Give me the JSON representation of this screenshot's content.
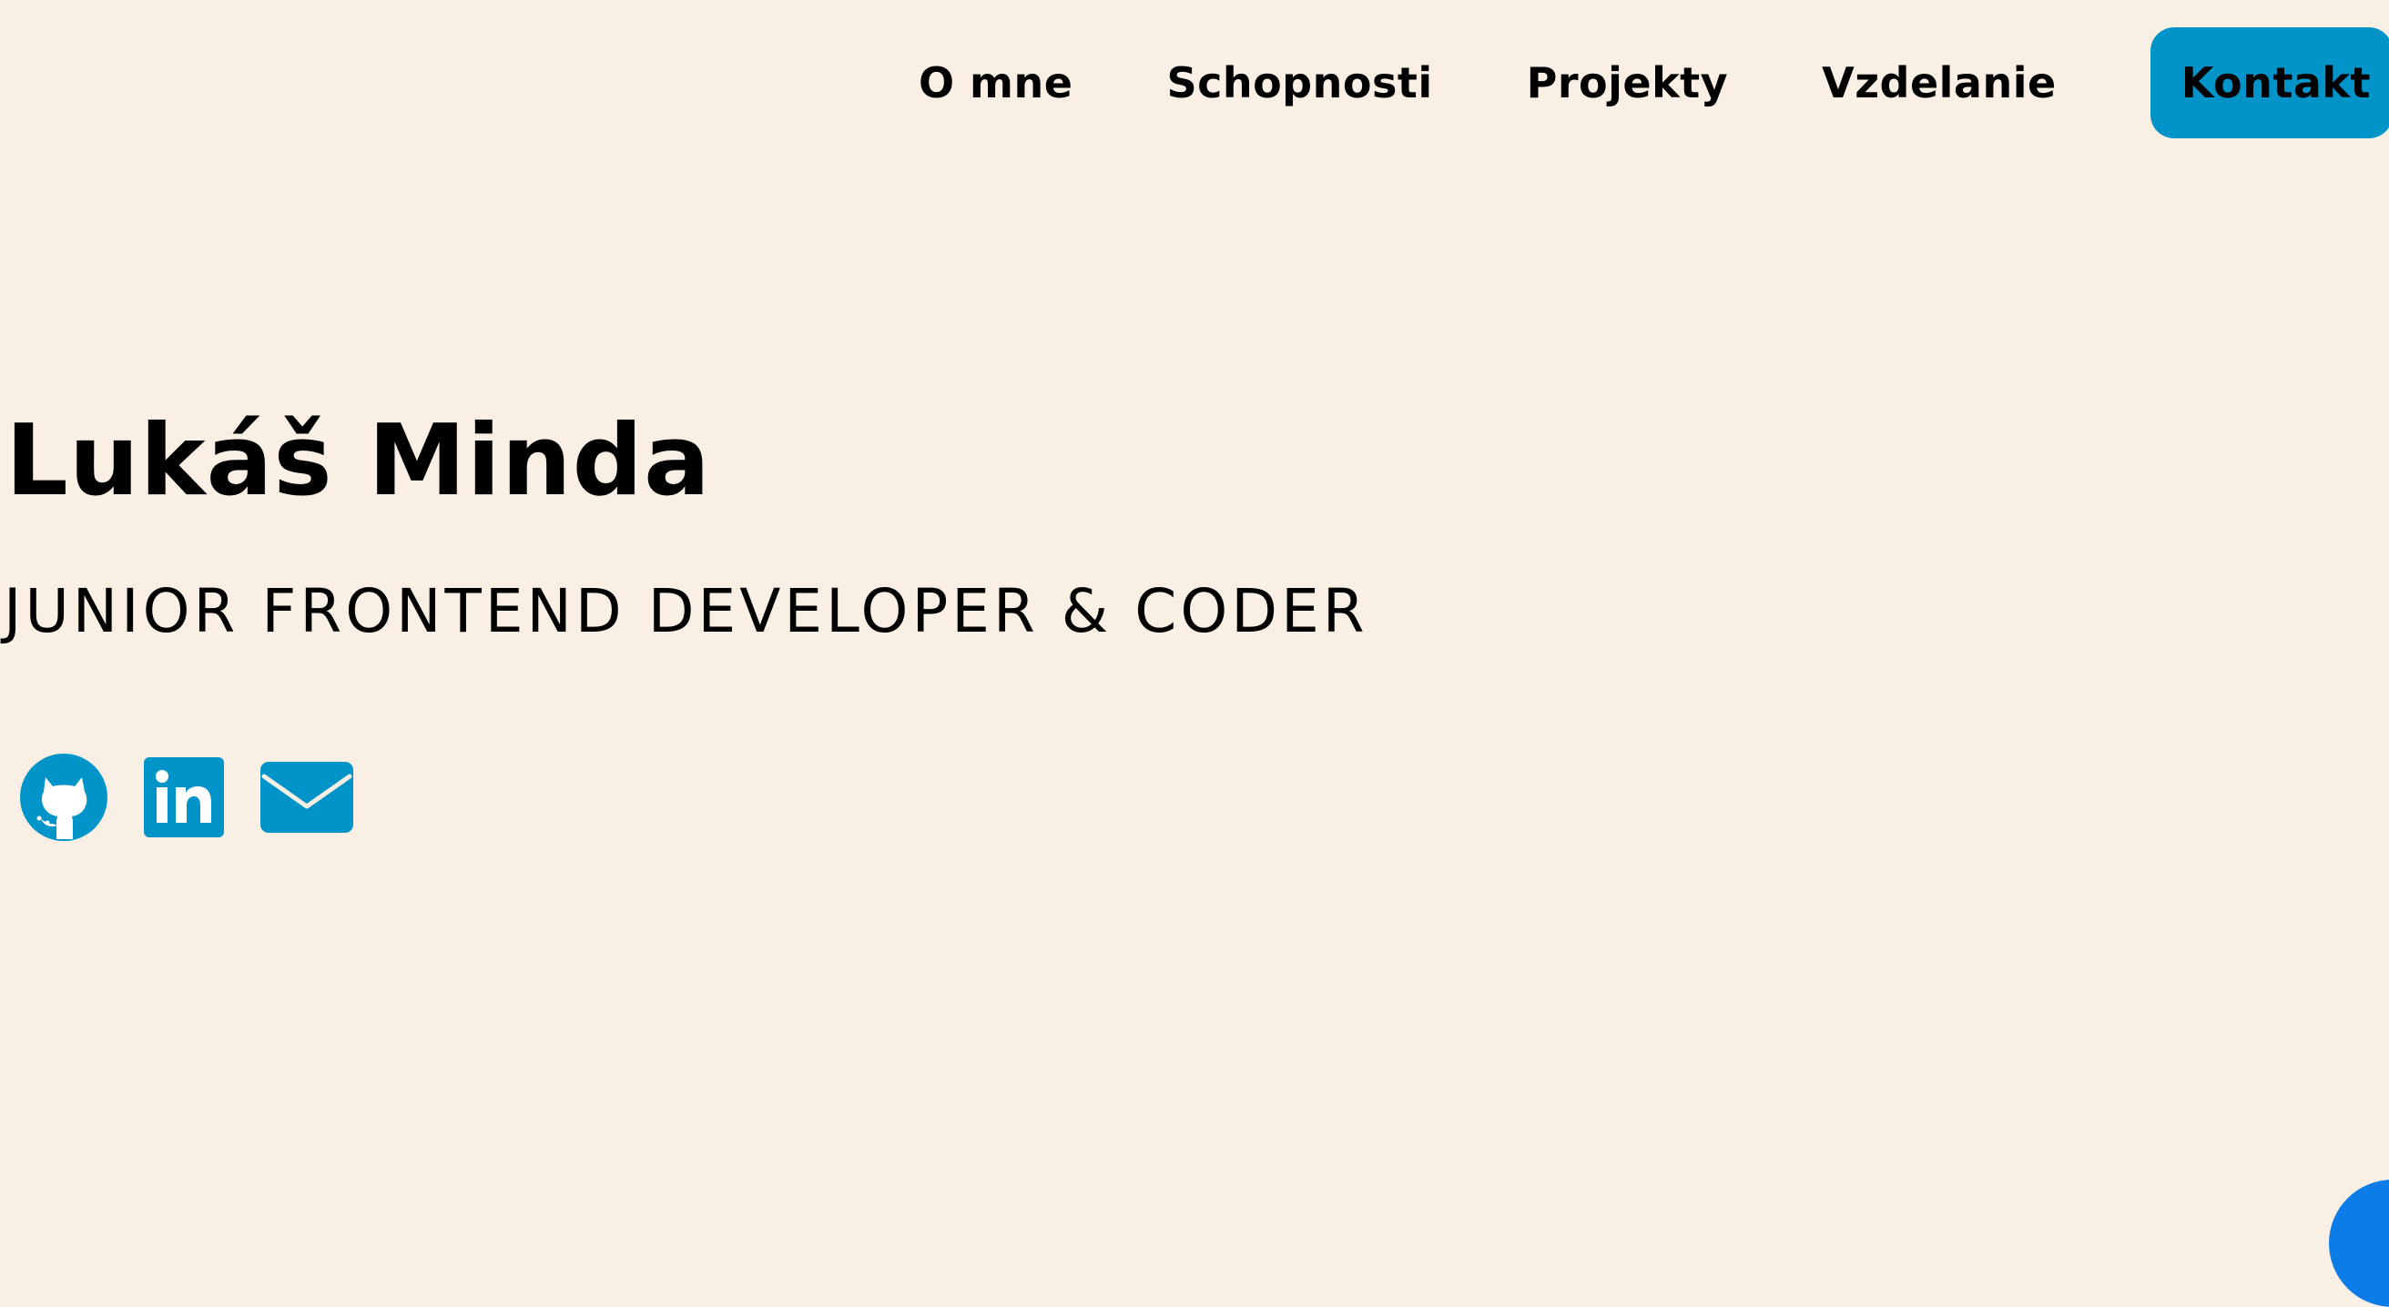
{
  "nav": {
    "items": [
      {
        "label": "O mne"
      },
      {
        "label": "Schopnosti"
      },
      {
        "label": "Projekty"
      },
      {
        "label": "Vzdelanie"
      }
    ],
    "cta_label": "Kontakt"
  },
  "hero": {
    "name": "Lukáš Minda",
    "role": "JUNIOR FRONTEND DEVELOPER & CODER"
  },
  "socials": [
    {
      "icon": "github-icon"
    },
    {
      "icon": "linkedin-icon"
    },
    {
      "icon": "mail-icon"
    }
  ],
  "colors": {
    "background": "#f9efe5",
    "accent": "#0194c9",
    "text": "#000000",
    "fab": "#0b7ce8"
  }
}
